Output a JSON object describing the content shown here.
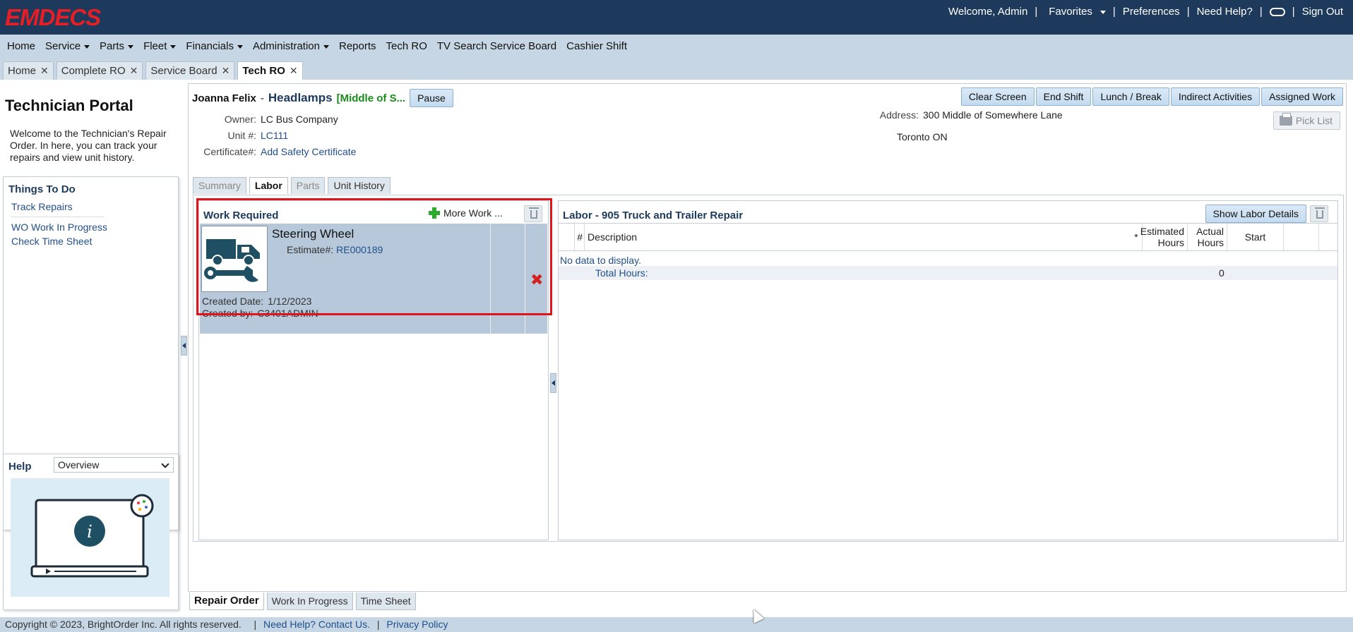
{
  "brand": {
    "logo": "EMDECS",
    "color": "#e61e25"
  },
  "topbar": {
    "welcome": "Welcome, Admin",
    "favorites": "Favorites",
    "preferences": "Preferences",
    "help": "Need Help?",
    "signout": "Sign Out"
  },
  "menu": [
    "Home",
    "Service",
    "Parts",
    "Fleet",
    "Financials",
    "Administration",
    "Reports",
    "Tech RO",
    "TV Search Service Board",
    "Cashier Shift"
  ],
  "menu_dropdown": [
    false,
    true,
    true,
    true,
    true,
    true,
    false,
    false,
    false,
    false
  ],
  "tabs": [
    {
      "label": "Home"
    },
    {
      "label": "Complete RO"
    },
    {
      "label": "Service Board"
    },
    {
      "label": "Tech RO",
      "active": true
    }
  ],
  "sidebar": {
    "title": "Technician Portal",
    "welcome": "Welcome to the Technician's Repair Order. In here, you can track your repairs and view unit history.",
    "todo_title": "Things To Do",
    "todo_links": [
      "Track Repairs",
      "WO Work In Progress",
      "Check Time Sheet"
    ],
    "help_title": "Help",
    "help_select": "Overview"
  },
  "header": {
    "tech_name": "Joanna Felix",
    "job": "Headlamps",
    "location": "[Middle of S...",
    "pause": "Pause",
    "actions": [
      "Clear Screen",
      "End Shift",
      "Lunch / Break",
      "Indirect Activities",
      "Assigned Work"
    ],
    "pick_list": "Pick List"
  },
  "details": {
    "owner_label": "Owner:",
    "owner": "LC Bus Company",
    "unit_label": "Unit #:",
    "unit": "LC111",
    "cert_label": "Certificate#:",
    "cert": "Add Safety Certificate",
    "address_label": "Address:",
    "address1": "300 Middle of Somewhere Lane",
    "address2": "Toronto ON"
  },
  "subtabs": [
    "Summary",
    "Labor",
    "Parts",
    "Unit History"
  ],
  "work_required": {
    "title": "Work Required",
    "more_work": "More Work ...",
    "card": {
      "title": "Steering Wheel",
      "estimate_label": "Estimate#:",
      "estimate": "RE000189",
      "created_date_label": "Created Date:",
      "created_date": "1/12/2023",
      "created_by_label": "Created by:",
      "created_by": "C3401ADMIN"
    }
  },
  "labor": {
    "title": "Labor - 905 Truck and Trailer Repair",
    "show_details": "Show Labor Details",
    "columns": {
      "num": "#",
      "desc": "Description",
      "star": "*",
      "est_1": "Estimated",
      "est_2": "Hours",
      "act_1": "Actual",
      "act_2": "Hours",
      "start": "Start"
    },
    "no_data": "No data to display.",
    "total_label": "Total Hours:",
    "total_value": "0"
  },
  "bottom_tabs": [
    "Repair Order",
    "Work In Progress",
    "Time Sheet"
  ],
  "footer": {
    "copyright": "Copyright © 2023, BrightOrder Inc. All rights reserved.",
    "contact": "Need Help? Contact Us.",
    "privacy": "Privacy Policy"
  }
}
